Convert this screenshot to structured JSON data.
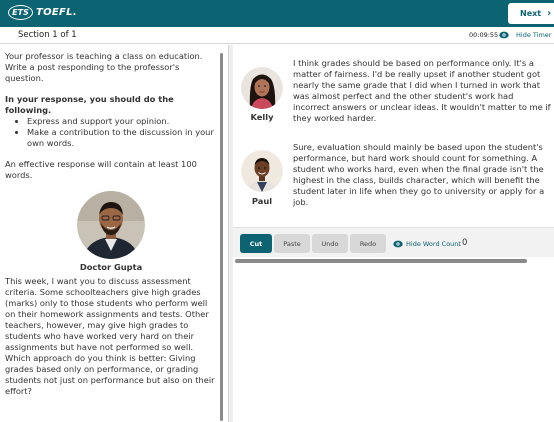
{
  "header": {
    "logo_mark": "ETS",
    "logo_text": "TOEFL.",
    "next_label": "Next"
  },
  "subheader": {
    "section_label": "Section 1 of 1",
    "timer_value": "00:09:55",
    "hide_timer_label": "Hide Timer"
  },
  "prompt": {
    "intro": "Your professor is teaching a class on education. Write a post responding to the professor's question.",
    "instructions_heading": "In your response, you should do the following.",
    "bullets": [
      "Express and support your opinion.",
      "Make a contribution to the discussion in your own words."
    ],
    "length_note": "An effective response will contain at least 100 words.",
    "professor_name": "Doctor Gupta",
    "professor_question": "This week, I want you to discuss assessment criteria. Some schoolteachers give high grades (marks) only to those students who perform well on their homework assignments and tests. Other teachers, however, may give high grades to students who have worked very hard on their assignments but have not performed so well. Which approach do you think is better: Giving grades based only on performance, or grading students not just on performance but also on their effort?"
  },
  "students": [
    {
      "name": "Kelly",
      "post": "I think grades should be based on performance only. It's a matter of fairness. I'd be really upset if another student got nearly the same grade that I did when I turned in work that was almost perfect and the other student's work had incorrect answers or unclear ideas. It wouldn't matter to me if they worked harder."
    },
    {
      "name": "Paul",
      "post": "Sure, evaluation should mainly be based upon the student's performance, but hard work should count for something. A student who works hard, even when the final grade isn't the highest in the class, builds character, which will benefit the student later in life when they go to university or apply for a job."
    }
  ],
  "toolbar": {
    "cut_label": "Cut",
    "paste_label": "Paste",
    "undo_label": "Undo",
    "redo_label": "Redo",
    "hide_word_count_label": "Hide Word Count",
    "word_count": "0"
  },
  "colors": {
    "brand": "#0c6473",
    "button_disabled": "#d8d8d8"
  },
  "icons": [
    "ets-logo",
    "chevron-right-icon",
    "eye-icon"
  ]
}
